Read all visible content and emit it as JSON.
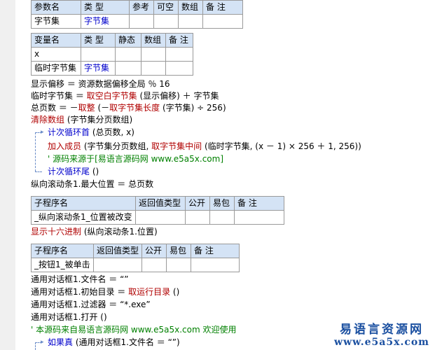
{
  "param_table": {
    "headers": [
      "参数名",
      "类 型",
      "参考",
      "可空",
      "数组",
      "备 注"
    ],
    "row": [
      "字节集",
      "字节集",
      "",
      "",
      "",
      ""
    ]
  },
  "var_table": {
    "headers": [
      "变量名",
      "类 型",
      "静态",
      "数组",
      "备 注"
    ],
    "rows": [
      [
        "x",
        "",
        "",
        "",
        ""
      ],
      [
        "临时字节集",
        "字节集",
        "",
        "",
        ""
      ]
    ]
  },
  "code1": {
    "l1": "显示偏移 ＝ 资源数据偏移全局 ％ 16",
    "l2a": "临时字节集 ＝ ",
    "l2b": "取空白字节集",
    "l2c": " (显示偏移) ＋ 字节集",
    "l3a": "总页数 ＝ －",
    "l3b": "取整",
    "l3c": " (－",
    "l3d": "取字节集长度",
    "l3e": " (字节集) ÷ 256)",
    "l4a": "清除数组",
    "l4b": " (字节集分页数组)",
    "l5a": "计次循环首",
    "l5b": " (总页数, x)",
    "l6a": "加入成员",
    "l6b": " (字节集分页数组, ",
    "l6c": "取字节集中间",
    "l6d": " (临时字节集, (x － 1) × 256 ＋ 1, 256))",
    "l7": "' 源码来源于[易语言源码网 www.e5a5x.com]",
    "l8a": "计次循环尾",
    "l8b": " ()",
    "l9": "纵向滚动条1.最大位置 ＝ 总页数"
  },
  "sub1": {
    "headers": [
      "子程序名",
      "返回值类型",
      "公开",
      "易包",
      "备 注"
    ],
    "row": [
      "_纵向滚动条1_位置被改变",
      "",
      "",
      "",
      ""
    ]
  },
  "code2": {
    "l1a": "显示十六进制",
    "l1b": " (纵向滚动条1.位置)"
  },
  "sub2": {
    "headers": [
      "子程序名",
      "返回值类型",
      "公开",
      "易包",
      "备 注"
    ],
    "row": [
      "_按钮1_被单击",
      "",
      "",
      "",
      ""
    ]
  },
  "code3": {
    "l1": "通用对话框1.文件名 ＝ “”",
    "l2a": "通用对话框1.初始目录 ＝ ",
    "l2b": "取运行目录",
    "l2c": " ()",
    "l3": "通用对话框1.过滤器 ＝ “*.exe”",
    "l4": "通用对话框1.打开 ()",
    "l5": "' 本源码来自易语言源码网 www.e5a5x.com  欢迎使用",
    "l6a": "如果真",
    "l6b": " (通用对话框1.文件名 ＝ “”)"
  },
  "watermark": {
    "title": "易语言资源网",
    "url": "www.e5a5x.com"
  }
}
